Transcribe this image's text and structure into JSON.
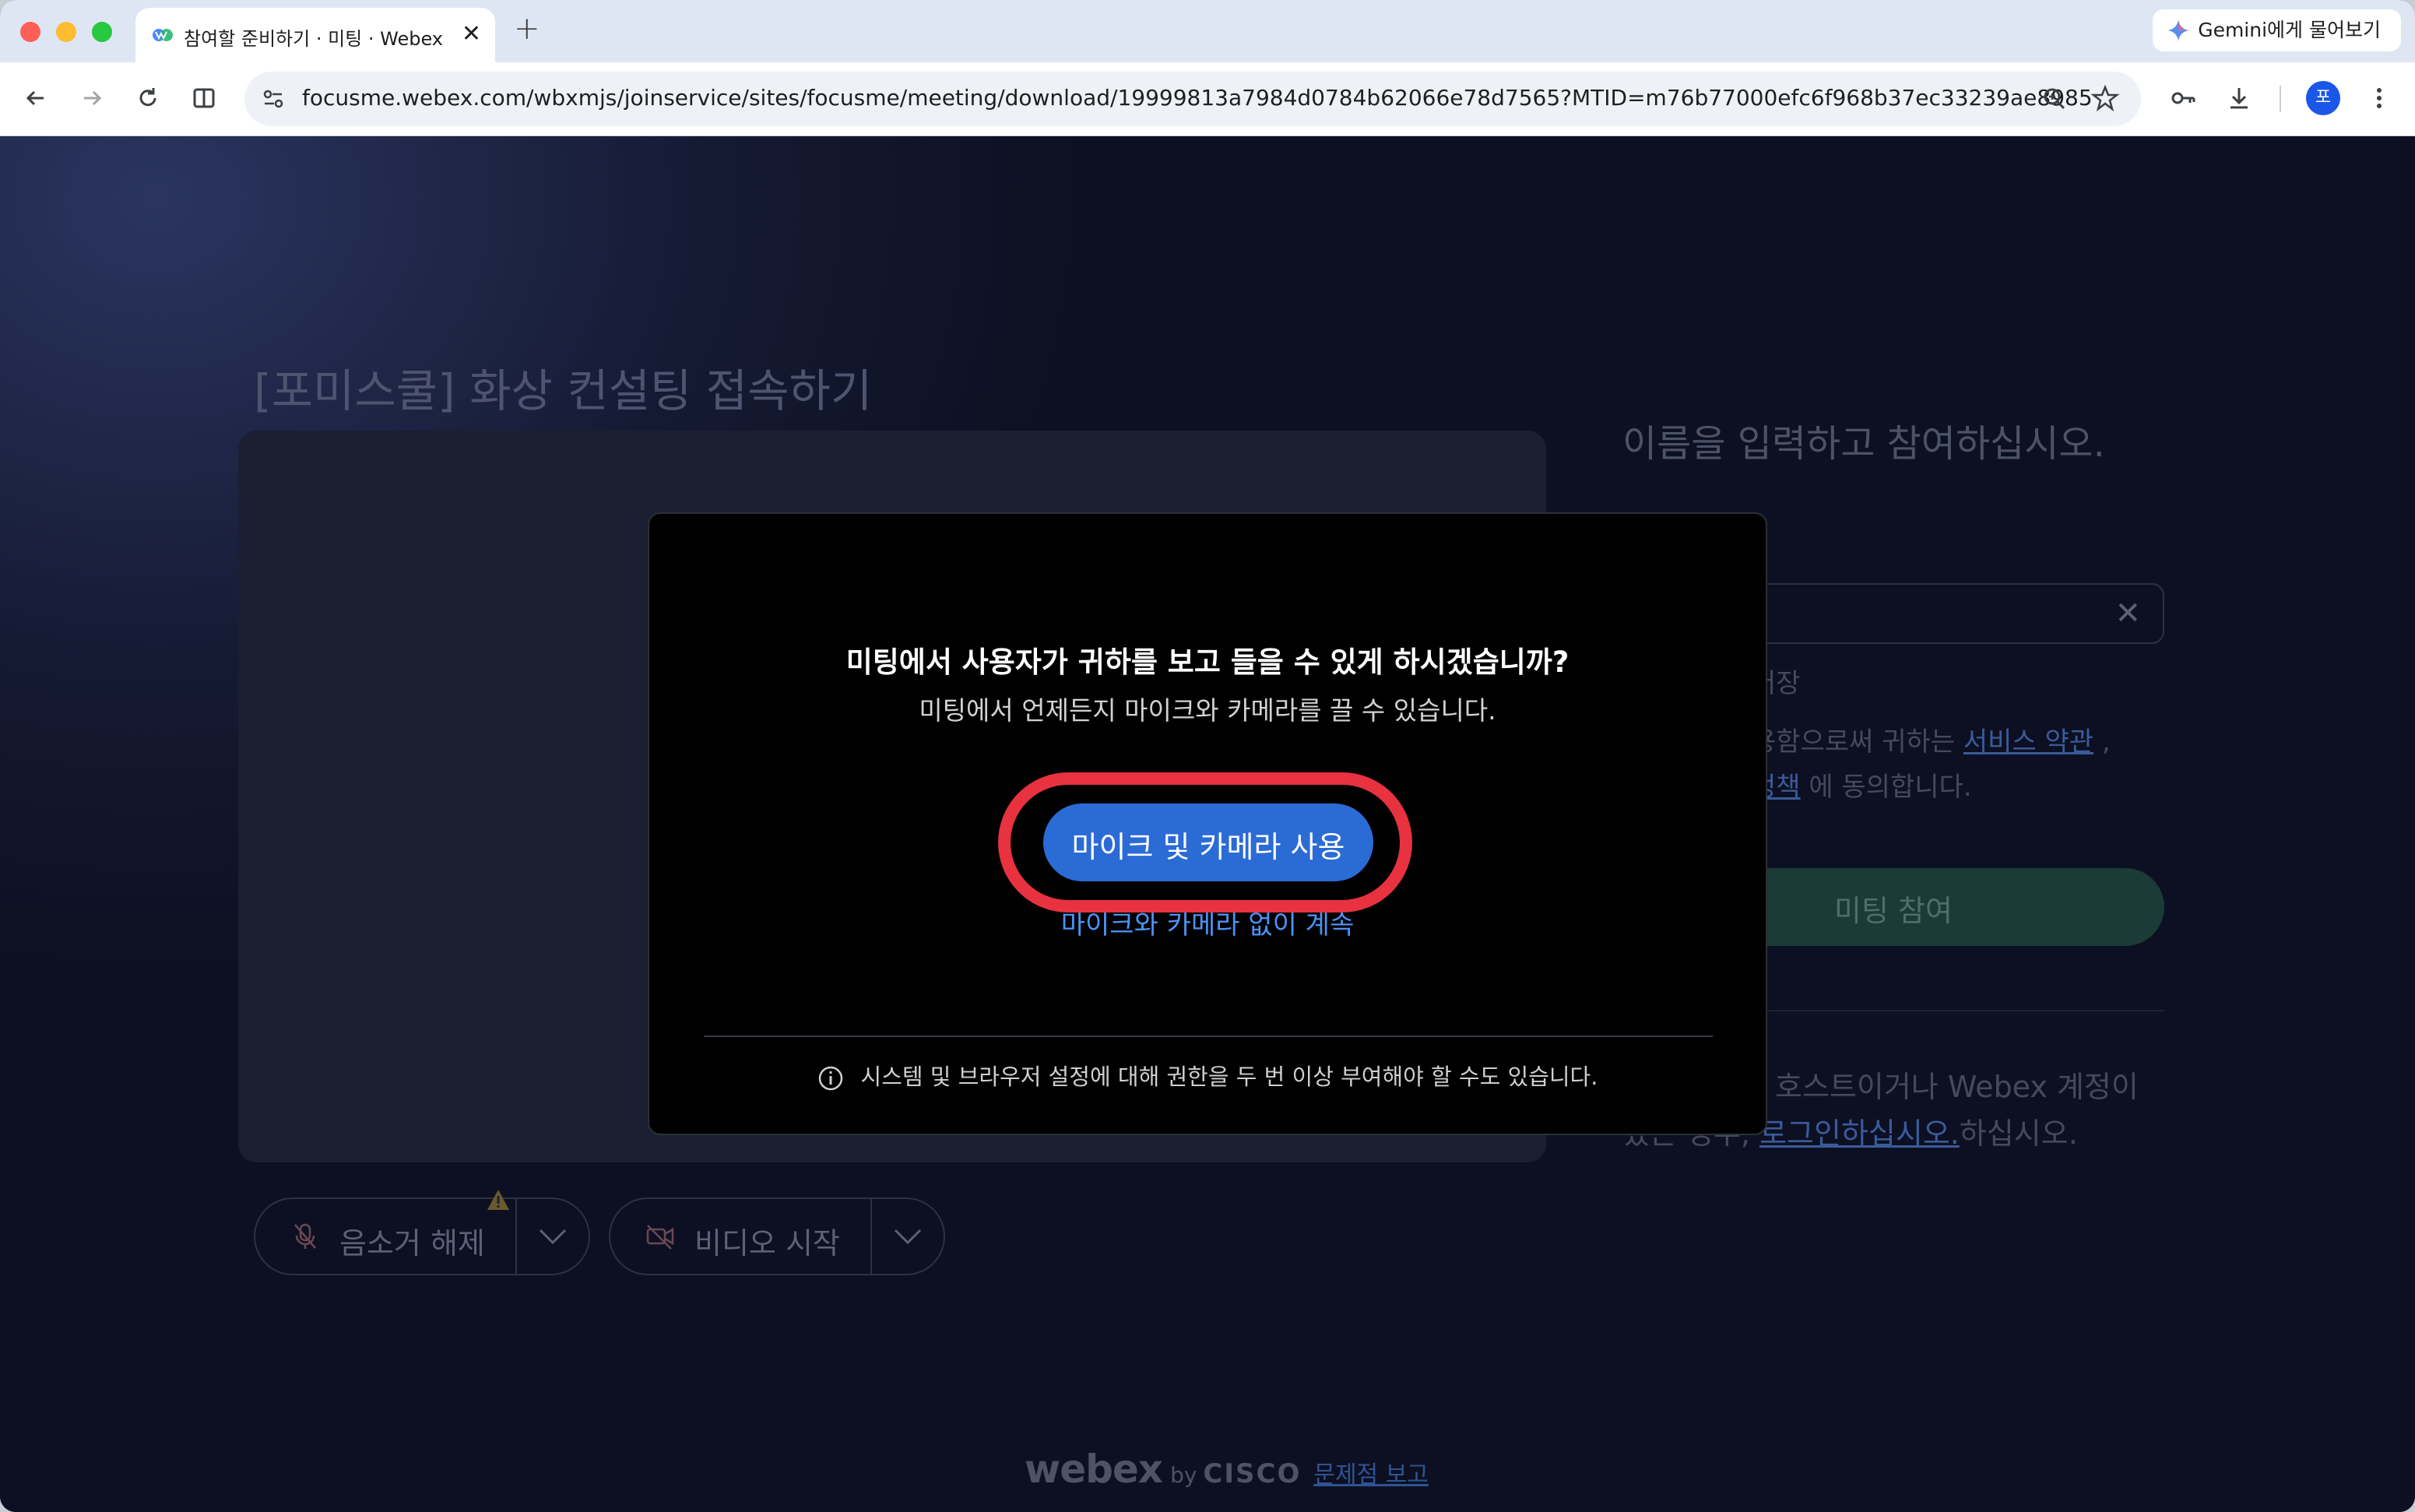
{
  "browser": {
    "tab_title": "참여할 준비하기 · 미팅 · Webex",
    "tab_close": "✕",
    "new_tab": "+",
    "gemini_label": "Gemini에게 물어보기",
    "url": "focusme.webex.com/wbxmjs/joinservice/sites/focusme/meeting/download/19999813a7984d0784b62066e78d7565?MTID=m76b77000efc6f968b37ec33239ae8985",
    "profile_initial": "포"
  },
  "page": {
    "meeting_title": "[포미스쿨] 화상 컨설팅 접속하기",
    "right_heading": "이름을 입력하고 참여하십시오.",
    "name_clear": "✕",
    "remember_fragment": "저장",
    "terms_line1_prefix": "용함으로써 귀하는 ",
    "terms_of_service": "서비스 약관",
    "terms_line1_suffix": " ,",
    "terms_privacy_fragment": "정책",
    "terms_line2_suffix": " 에 동의합니다.",
    "join_button": "미팅 참여",
    "host_line1": "호스트이거나 Webex 계정이",
    "host_line2_prefix": "있는 경우, ",
    "host_login_link": "로그인하십시오.",
    "host_line2_suffix": "하십시오.",
    "mute_label": "음소거 해제",
    "video_label": "비디오 시작",
    "brand_webex": "webex",
    "brand_by": "by",
    "brand_cisco": "CISCO",
    "report_link": "문제점 보고"
  },
  "modal": {
    "title": "미팅에서 사용자가 귀하를 보고 들을 수 있게 하시겠습니까?",
    "subtitle": "미팅에서 언제든지 마이크와 카메라를 끌 수 있습니다.",
    "allow_button": "마이크 및 카메라 사용",
    "without_link": "마이크와 카메라 없이 계속",
    "notice": "시스템 및 브라우저 설정에 대해 권한을 두 번 이상 부여해야 할 수도 있습니다."
  },
  "colors": {
    "accent_blue": "#2b6bd6",
    "highlight_red": "#e8323f",
    "join_green_dim": "#1b3b36"
  }
}
